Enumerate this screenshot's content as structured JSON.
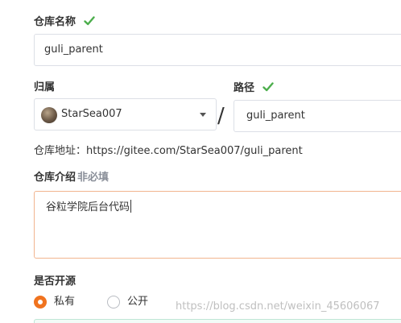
{
  "repo_name": {
    "label": "仓库名称",
    "value": "guli_parent"
  },
  "owner": {
    "label": "归属",
    "value": "StarSea007"
  },
  "separator": "/",
  "path": {
    "label": "路径",
    "value": "guli_parent"
  },
  "address": {
    "text": "仓库地址：https://gitee.com/StarSea007/guli_parent"
  },
  "description": {
    "label": "仓库介绍",
    "optional_hint": "非必填",
    "value": "谷粒学院后台代码"
  },
  "visibility": {
    "label": "是否开源",
    "options": [
      {
        "label": "私有",
        "selected": true
      },
      {
        "label": "公开",
        "selected": false
      }
    ]
  },
  "watermark": "https://blog.csdn.net/weixin_45606067",
  "colors": {
    "check_green": "#4cae4c",
    "accent_orange": "#f0731f",
    "focus_border": "#f2b58f"
  }
}
